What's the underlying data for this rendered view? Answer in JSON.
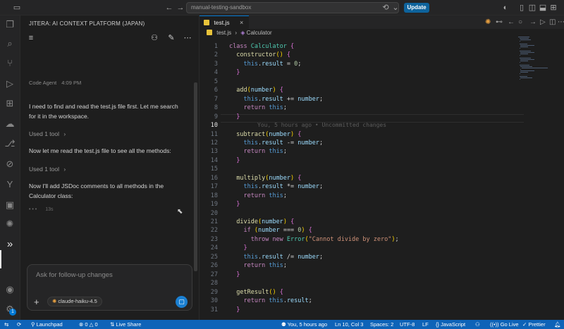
{
  "titlebar": {
    "search_text": "manual-testing-sandbox",
    "update_label": "Update",
    "icons": [
      "sidebar-toggle-icon",
      "arrow-left-icon",
      "arrow-right-icon",
      "sync-icon",
      "chevron-down-icon",
      "color-mode-icon",
      "layout-icon",
      "split-icon",
      "split-horizontal-icon",
      "layout-customize-icon"
    ]
  },
  "activity": {
    "icons": [
      "files-icon",
      "search-icon",
      "source-control-icon",
      "run-debug-icon",
      "extensions-icon",
      "remote-icon",
      "git-branch-icon",
      "remote-explorer-icon",
      "source-control-alt-icon",
      "terminal-icon",
      "jitera-icon",
      "chevrons-icon",
      "account-icon",
      "settings-icon"
    ],
    "settings_badge": "1"
  },
  "panel": {
    "title": "JITERA: AI CONTEXT PLATFORM (JAPAN)",
    "agent": "Code Agent",
    "time": "4:09 PM",
    "messages": [
      "I need to find and read the test.js file first. Let me search for it in the workspace.",
      "Now let me read the test.js file to see all the methods:",
      "Now I'll add JSDoc comments to all methods in the Calculator class:"
    ],
    "tools": [
      "Used 1 tool",
      "Used 1 tool"
    ],
    "tool_chevron": "›",
    "thinking_dots": "• • •",
    "elapsed": "13s",
    "input_placeholder": "Ask for follow-up changes",
    "plus": "+",
    "model": "claude-haiku-4.5"
  },
  "editor": {
    "tab": "test.js",
    "tab_close": "×",
    "breadcrumb_file": "test.js",
    "breadcrumb_sep": "›",
    "breadcrumb_symbol": "Calculator",
    "current_line": 10,
    "blame": "You, 5 hours ago • Uncommitted changes",
    "lines": [
      "class Calculator {",
      "  constructor() {",
      "    this.result = 0;",
      "  }",
      "",
      "  add(number) {",
      "    this.result += number;",
      "    return this;",
      "  }",
      "",
      "  subtract(number) {",
      "    this.result -= number;",
      "    return this;",
      "  }",
      "",
      "  multiply(number) {",
      "    this.result *= number;",
      "    return this;",
      "  }",
      "",
      "  divide(number) {",
      "    if (number === 0) {",
      "      throw new Error(\"Cannot divide by zero\");",
      "    }",
      "    this.result /= number;",
      "    return this;",
      "  }",
      "",
      "  getResult() {",
      "    return this.result;",
      "  }"
    ]
  },
  "statusbar": {
    "launchpad": "Launchpad",
    "errors": "0",
    "warnings": "0",
    "live_share": "Live Share",
    "blame": "You, 5 hours ago",
    "position": "Ln 10, Col 3",
    "spaces": "Spaces: 2",
    "encoding": "UTF-8",
    "eol": "LF",
    "language": "JavaScript",
    "go_live": "Go Live",
    "prettier": "Prettier"
  }
}
